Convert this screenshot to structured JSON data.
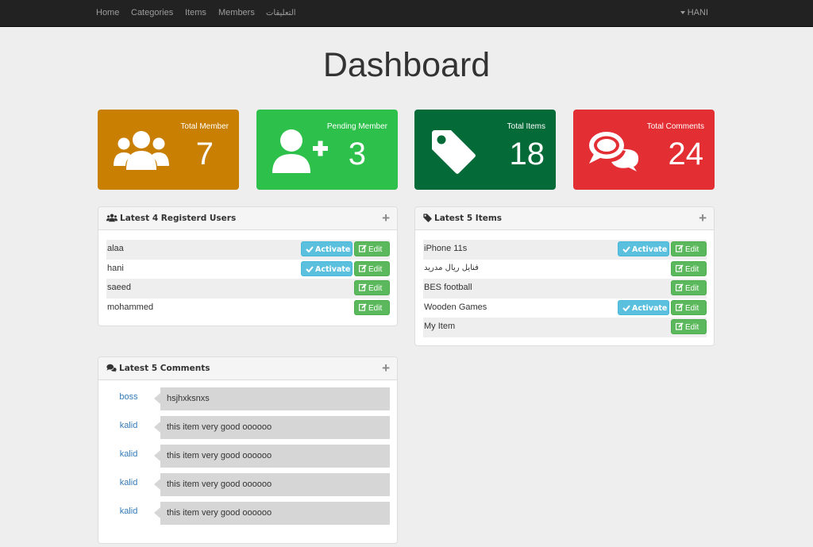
{
  "nav": {
    "links": [
      "Home",
      "Categories",
      "Items",
      "Members",
      "التعليقات"
    ],
    "user": "HANI"
  },
  "page": {
    "title": "Dashboard"
  },
  "stats": [
    {
      "label": "Total Member",
      "value": "7",
      "color": "#c97f01",
      "icon": "users-icon"
    },
    {
      "label": "Pending Member",
      "value": "3",
      "color": "#2dc14b",
      "icon": "user-plus-icon"
    },
    {
      "label": "Total Items",
      "value": "18",
      "color": "#036a38",
      "icon": "tag-icon"
    },
    {
      "label": "Total Comments",
      "value": "24",
      "color": "#e32e33",
      "icon": "comments-icon"
    }
  ],
  "users_panel": {
    "title": "Latest 4 Registerd Users",
    "plus": "+",
    "rows": [
      {
        "name": "alaa",
        "activate": "Activate",
        "edit": "Edit"
      },
      {
        "name": "hani",
        "activate": "Activate",
        "edit": "Edit"
      },
      {
        "name": "saeed",
        "edit": "Edit"
      },
      {
        "name": "mohammed",
        "edit": "Edit"
      }
    ]
  },
  "items_panel": {
    "title": "Latest 5 Items",
    "plus": "+",
    "rows": [
      {
        "name": "iPhone 11s",
        "activate": "Activate",
        "edit": "Edit"
      },
      {
        "name": "فنايل ريال مدريد",
        "edit": "Edit"
      },
      {
        "name": "BES football",
        "edit": "Edit"
      },
      {
        "name": "Wooden Games",
        "activate": "Activate",
        "edit": "Edit"
      },
      {
        "name": "My Item",
        "edit": "Edit"
      }
    ]
  },
  "comments_panel": {
    "title": "Latest 5 Comments",
    "plus": "+",
    "rows": [
      {
        "user": "boss",
        "text": "hsjhxksnxs"
      },
      {
        "user": "kalid",
        "text": "this item very good oooooo"
      },
      {
        "user": "kalid",
        "text": "this item very good oooooo"
      },
      {
        "user": "kalid",
        "text": "this item very good oooooo"
      },
      {
        "user": "kalid",
        "text": "this item very good oooooo"
      }
    ]
  }
}
